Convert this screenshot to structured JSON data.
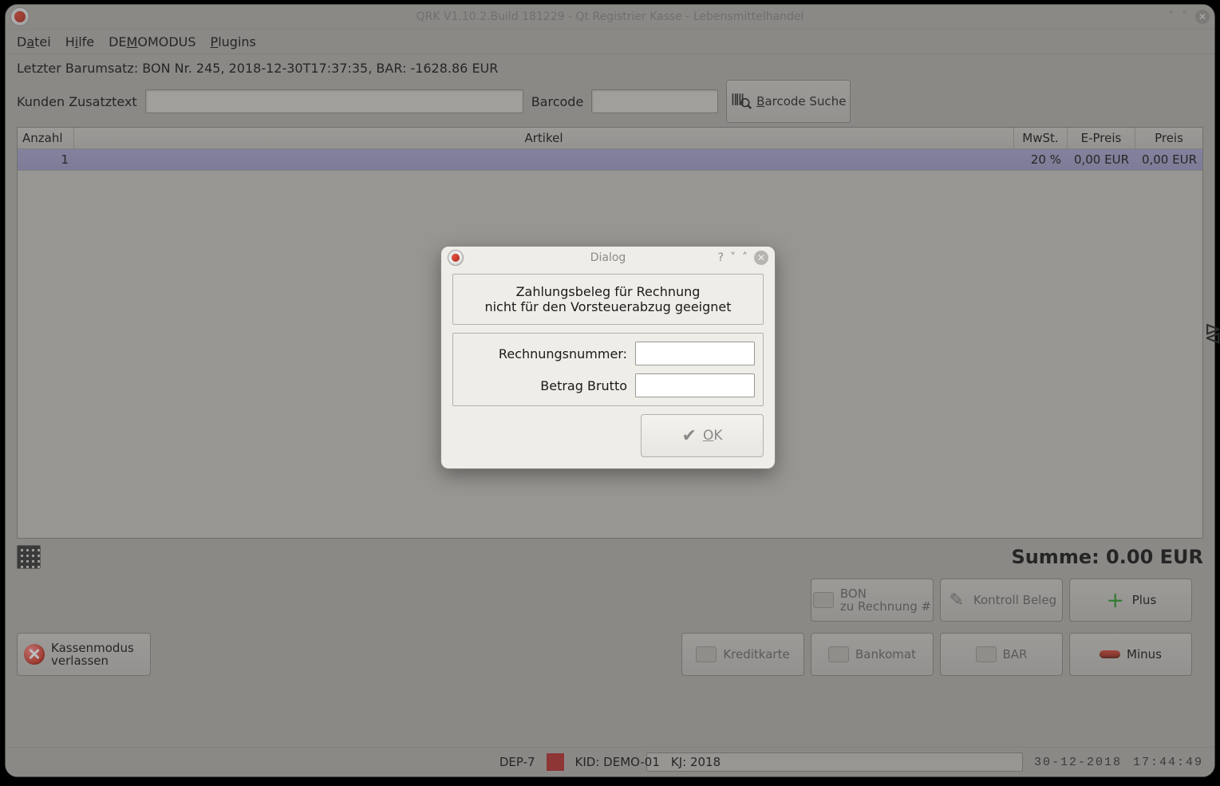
{
  "window": {
    "title": "QRK V1.10.2.Build 181229 - Qt Registrier Kasse - Lebensmittelhandel",
    "minimize_glyph": "˅",
    "maximize_glyph": "˄",
    "close_glyph": "✕"
  },
  "menu": {
    "datei_pre": "D",
    "datei_u": "a",
    "datei_post": "tei",
    "hilfe_pre": "H",
    "hilfe_u": "i",
    "hilfe_post": "lfe",
    "demo_pre": "DE",
    "demo_u": "M",
    "demo_post": "OMODUS",
    "plugins_pre": "",
    "plugins_u": "P",
    "plugins_post": "lugins"
  },
  "top": {
    "last_line": "Letzter Barumsatz: BON Nr. 245, 2018-12-30T17:37:35, BAR: -1628.86 EUR",
    "kunden_label": "Kunden Zusatztext",
    "kunden_value": "",
    "barcode_label": "Barcode",
    "barcode_value": "",
    "barcode_btn_pre": "",
    "barcode_btn_u": "B",
    "barcode_btn_post": "arcode Suche"
  },
  "table": {
    "headers": {
      "anzahl": "Anzahl",
      "artikel": "Artikel",
      "mwst": "MwSt.",
      "epreis": "E-Preis",
      "preis": "Preis"
    },
    "rows": [
      {
        "anzahl": "1",
        "artikel": "",
        "mwst": "20 %",
        "epreis": "0,00 EUR",
        "preis": "0,00 EUR"
      }
    ]
  },
  "summary": {
    "summe": "Summe: 0.00 EUR"
  },
  "actions": {
    "kassenmodus_line1": "Kassenmodus",
    "kassenmodus_line2": "verlassen",
    "bon_line1": "BON",
    "bon_line2": "zu Rechnung #",
    "kontroll": "Kontroll Beleg",
    "plus": "Plus",
    "kreditkarte": "Kreditkarte",
    "bankomat": "Bankomat",
    "bar": "BAR",
    "minus": "Minus"
  },
  "statusbar": {
    "dep": "DEP-7",
    "kid": "KID: DEMO-01",
    "kj": "KJ: 2018",
    "date": "30-12-2018",
    "time": "17:44:49"
  },
  "dialog": {
    "title": "Dialog",
    "help_glyph": "?",
    "down_glyph": "˅",
    "up_glyph": "˄",
    "close_glyph": "✕",
    "line1": "Zahlungsbeleg für Rechnung",
    "line2": "nicht für den Vorsteuerabzug geeignet",
    "rechnr_label": "Rechnungsnummer:",
    "rechnr_value": "",
    "brutto_label": "Betrag Brutto",
    "brutto_value": "",
    "ok_pre": "",
    "ok_u": "O",
    "ok_post": "K"
  }
}
